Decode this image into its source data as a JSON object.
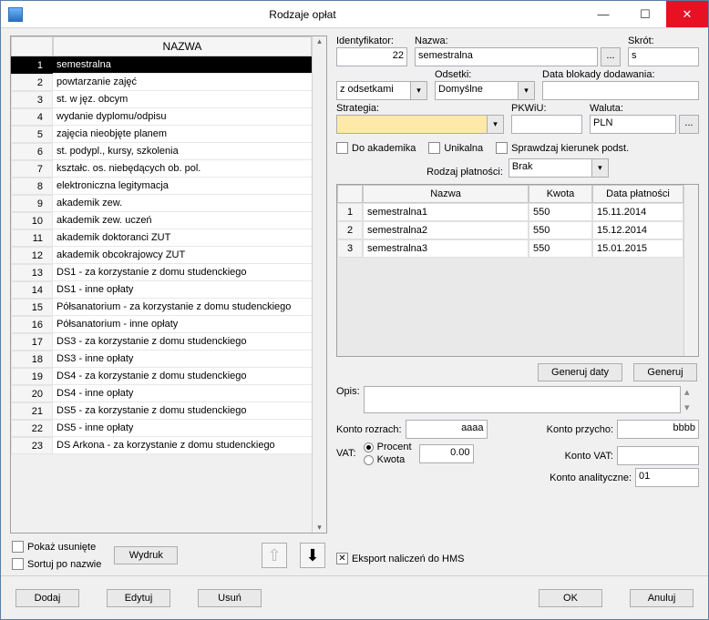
{
  "window": {
    "title": "Rodzaje opłat"
  },
  "list": {
    "header_num": "",
    "header_name": "NAZWA",
    "items": [
      "semestralna",
      "powtarzanie zajęć",
      "st. w jęz. obcym",
      "wydanie dyplomu/odpisu",
      "zajęcia nieobjęte planem",
      "st. podypl., kursy, szkolenia",
      "kształc. os. niebędących ob. pol.",
      "elektroniczna legitymacja",
      "akademik zew.",
      "akademik zew. uczeń",
      "akademik doktoranci ZUT",
      "akademik obcokrajowcy ZUT",
      "DS1 - za korzystanie z domu studenckiego",
      "DS1 - inne opłaty",
      "Półsanatorium - za korzystanie z domu studenckiego",
      "Półsanatorium - inne opłaty",
      "DS3 - za korzystanie z domu studenckiego",
      "DS3 - inne opłaty",
      "DS4 - za korzystanie z domu studenckiego",
      "DS4 - inne opłaty",
      "DS5 - za korzystanie z domu studenckiego",
      "DS5 - inne opłaty",
      "DS Arkona - za korzystanie z domu studenckiego"
    ]
  },
  "left_opts": {
    "show_deleted": "Pokaż usunięte",
    "sort_by_name": "Sortuj po nazwie",
    "print": "Wydruk"
  },
  "fields": {
    "ident_label": "Identyfikator:",
    "ident_value": "22",
    "name_label": "Nazwa:",
    "name_value": "semestralna",
    "browse": "...",
    "short_label": "Skrót:",
    "short_value": "s",
    "odsetki_label": "Odsetki:",
    "odsetki_combo1": "z odsetkami",
    "odsetki_combo2": "Domyślne",
    "block_label": "Data blokady dodawania:",
    "block_value": "",
    "strategia_label": "Strategia:",
    "strategia_value": "",
    "pkwiu_label": "PKWiU:",
    "pkwiu_value": "",
    "waluta_label": "Waluta:",
    "waluta_value": "PLN",
    "chk_akademik": "Do akademika",
    "chk_unikalna": "Unikalna",
    "chk_kierunek": "Sprawdzaj kierunek podst.",
    "rodzaj_label": "Rodzaj płatności:",
    "rodzaj_value": "Brak"
  },
  "grid": {
    "headers": [
      "",
      "Nazwa",
      "Kwota",
      "Data płatności"
    ],
    "rows": [
      {
        "n": "1",
        "name": "semestralna1",
        "amount": "550",
        "date": "15.11.2014"
      },
      {
        "n": "2",
        "name": "semestralna2",
        "amount": "550",
        "date": "15.12.2014"
      },
      {
        "n": "3",
        "name": "semestralna3",
        "amount": "550",
        "date": "15.01.2015"
      }
    ]
  },
  "buttons": {
    "gen_dates": "Generuj daty",
    "gen": "Generuj",
    "opis_label": "Opis:",
    "konto_rozrach_label": "Konto rozrach:",
    "konto_rozrach_value": "aaaa",
    "konto_przycho_label": "Konto przycho:",
    "konto_przycho_value": "bbbb",
    "vat_label": "VAT:",
    "vat_percent": "Procent",
    "vat_kwota": "Kwota",
    "vat_value": "0.00",
    "konto_vat_label": "Konto VAT:",
    "konto_vat_value": "",
    "konto_anal_label": "Konto analityczne:",
    "konto_anal_value": "01",
    "export_hms": "Eksport naliczeń do HMS"
  },
  "footer": {
    "add": "Dodaj",
    "edit": "Edytuj",
    "delete": "Usuń",
    "ok": "OK",
    "cancel": "Anuluj"
  }
}
